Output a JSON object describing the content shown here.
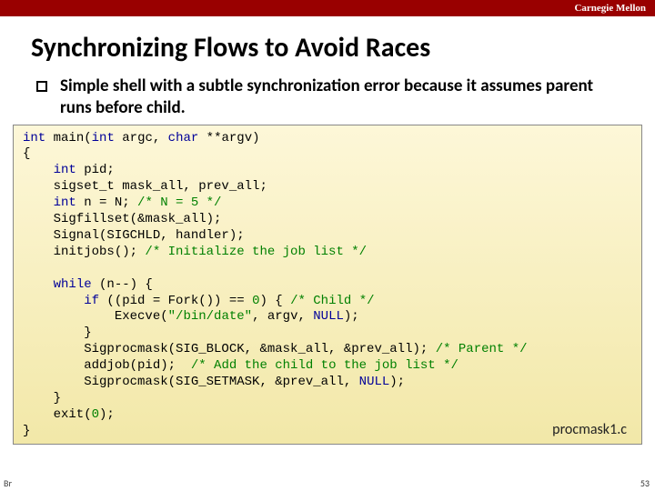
{
  "header": {
    "institution": "Carnegie Mellon"
  },
  "title": "Synchronizing Flows to Avoid Races",
  "bullet": "Simple shell with a subtle synchronization error because it assumes parent runs before child.",
  "code": {
    "l1a": "int",
    "l1b": " main(",
    "l1c": "int",
    "l1d": " argc, ",
    "l1e": "char",
    "l1f": " **argv)",
    "l2": "{",
    "l3a": "    ",
    "l3b": "int",
    "l3c": " pid;",
    "l4a": "    sigset_t mask_all, prev_all;",
    "l5a": "    ",
    "l5b": "int",
    "l5c": " n = N; ",
    "l5d": "/* N = 5 */",
    "l6": "    Sigfillset(&mask_all);",
    "l7": "    Signal(SIGCHLD, handler);",
    "l8a": "    initjobs(); ",
    "l8b": "/* Initialize the job list */",
    "l10a": "    ",
    "l10b": "while",
    "l10c": " (n--) {",
    "l11a": "        ",
    "l11b": "if",
    "l11c": " ((pid = Fork()) == ",
    "l11d": "0",
    "l11e": ") { ",
    "l11f": "/* Child */",
    "l12a": "            Execve(",
    "l12b": "\"/bin/date\"",
    "l12c": ", argv, ",
    "l12d": "NULL",
    "l12e": ");",
    "l13": "        }",
    "l14a": "        Sigprocmask(SIG_BLOCK, &mask_all, &prev_all); ",
    "l14b": "/* Parent */",
    "l15a": "        addjob(pid);  ",
    "l15b": "/* Add the child to the job list */",
    "l16a": "        Sigprocmask(SIG_SETMASK, &prev_all, ",
    "l16b": "NULL",
    "l16c": ");",
    "l17": "    }",
    "l18a": "    exit(",
    "l18b": "0",
    "l18c": ");",
    "l19": "}"
  },
  "filename": "procmask1.c",
  "footer_left": "Br",
  "pagenum": "53"
}
